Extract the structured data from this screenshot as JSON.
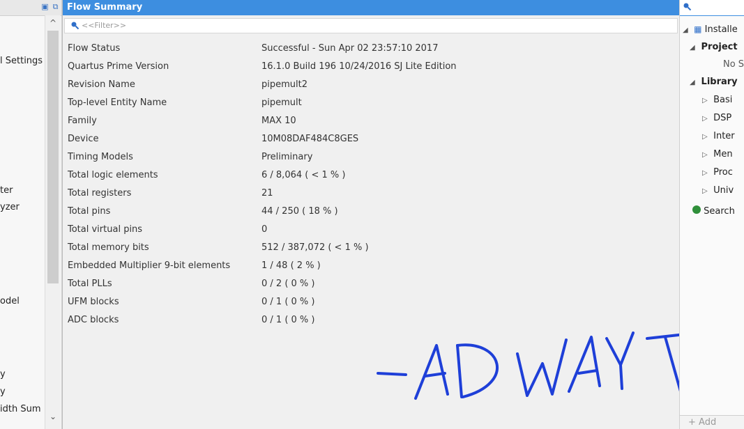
{
  "left_panel": {
    "items": [
      {
        "label": "l Settings"
      },
      {
        "label": "ter"
      },
      {
        "label": "yzer"
      },
      {
        "label": "odel"
      },
      {
        "label": "y"
      },
      {
        "label": "y"
      },
      {
        "label": "idth Sum"
      }
    ]
  },
  "flow_summary": {
    "title": "Flow Summary",
    "filter_placeholder": "<<Filter>>",
    "rows": [
      {
        "key": "Flow Status",
        "value": "Successful - Sun Apr 02 23:57:10 2017"
      },
      {
        "key": "Quartus Prime Version",
        "value": "16.1.0 Build 196 10/24/2016 SJ Lite Edition"
      },
      {
        "key": "Revision Name",
        "value": "pipemult2"
      },
      {
        "key": "Top-level Entity Name",
        "value": "pipemult"
      },
      {
        "key": "Family",
        "value": "MAX 10"
      },
      {
        "key": "Device",
        "value": "10M08DAF484C8GES"
      },
      {
        "key": "Timing Models",
        "value": "Preliminary"
      },
      {
        "key": "Total logic elements",
        "value": "6 / 8,064 ( < 1 % )"
      },
      {
        "key": "Total registers",
        "value": "21"
      },
      {
        "key": "Total pins",
        "value": "44 / 250 ( 18 % )"
      },
      {
        "key": "Total virtual pins",
        "value": "0"
      },
      {
        "key": "Total memory bits",
        "value": "512 / 387,072 ( < 1 % )"
      },
      {
        "key": "Embedded Multiplier 9-bit elements",
        "value": "1 / 48 ( 2 % )"
      },
      {
        "key": "Total PLLs",
        "value": "0 / 2 ( 0 % )"
      },
      {
        "key": "UFM blocks",
        "value": "0 / 1 ( 0 % )"
      },
      {
        "key": "ADC blocks",
        "value": "0 / 1 ( 0 % )"
      }
    ],
    "signature_text": "-ADWAYT"
  },
  "ip_catalog": {
    "tree": [
      {
        "label": "Installe",
        "arrow": "◢"
      },
      {
        "label": "Project",
        "arrow": "◢"
      },
      {
        "label": "No S",
        "arrow": ""
      },
      {
        "label": "Library",
        "arrow": "◢"
      },
      {
        "label": "Basi",
        "arrow": "▷"
      },
      {
        "label": "DSP",
        "arrow": "▷"
      },
      {
        "label": "Inter",
        "arrow": "▷"
      },
      {
        "label": "Men",
        "arrow": "▷"
      },
      {
        "label": "Proc",
        "arrow": "▷"
      },
      {
        "label": "Univ",
        "arrow": "▷"
      },
      {
        "label": "Search",
        "arrow": ""
      }
    ],
    "add_label": "+ Add"
  },
  "colors": {
    "title_bar": "#3d8ee0",
    "signature_ink": "#1e3fd8"
  }
}
